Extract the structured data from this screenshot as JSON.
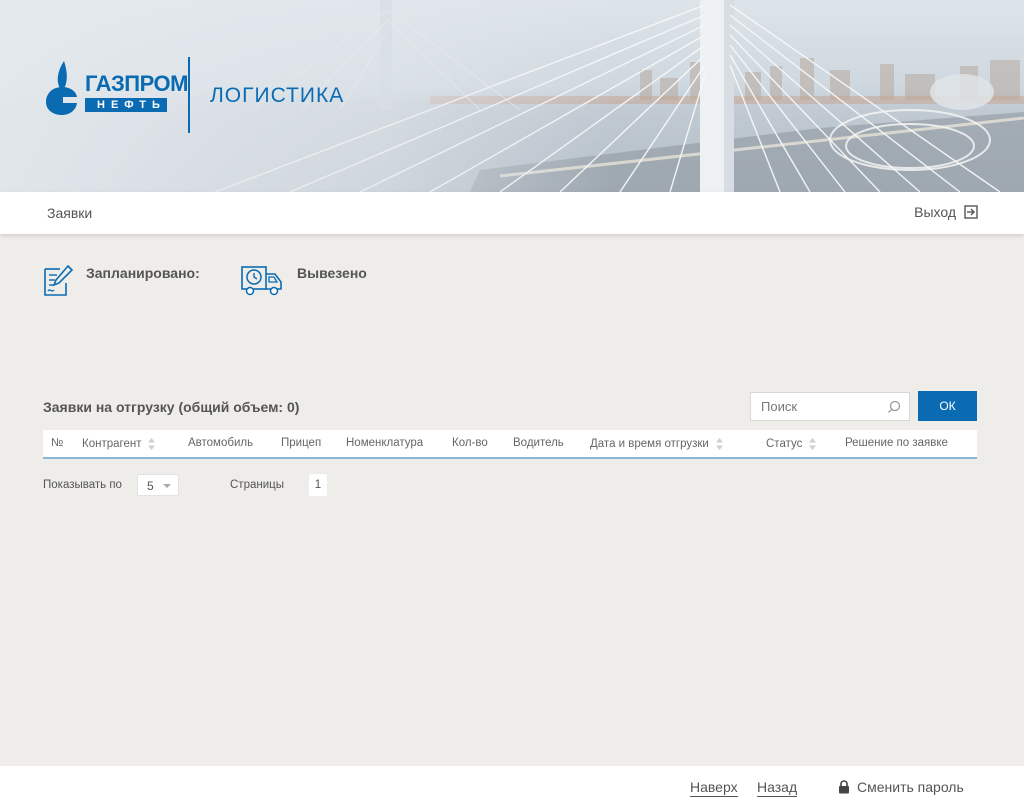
{
  "header": {
    "logo_line1": "ГАЗПРОМ",
    "logo_line2": "НЕФТЬ",
    "app_name": "ЛОГИСТИКА"
  },
  "nav": {
    "requests_link": "Заявки",
    "logout_label": "Выход"
  },
  "stats": {
    "planned_label": "Запланировано:",
    "shipped_label": "Вывезено"
  },
  "table": {
    "title": "Заявки на отгрузку (общий объем: 0)",
    "search_placeholder": "Поиск",
    "ok_label": "ОК",
    "columns": [
      "№",
      "Контрагент",
      "Автомобиль",
      "Прицеп",
      "Номенклатура",
      "Кол-во",
      "Водитель",
      "Дата и время отгрузки",
      "Статус",
      "Решение по заявке"
    ],
    "rows": []
  },
  "pagination": {
    "show_by_label": "Показывать по",
    "page_size": "5",
    "pages_label": "Страницы",
    "current_page": "1"
  },
  "footer": {
    "top_link": "Наверх",
    "back_link": "Назад",
    "change_password": "Сменить пароль"
  },
  "colors": {
    "brand_blue": "#0a6bb3",
    "background": "#efedea",
    "table_accent": "#8ab6da"
  },
  "icons": [
    "gazprom-flame-icon",
    "contract-pen-icon",
    "delivery-truck-clock-icon",
    "search-icon",
    "sort-icon",
    "logout-icon",
    "lock-icon"
  ]
}
